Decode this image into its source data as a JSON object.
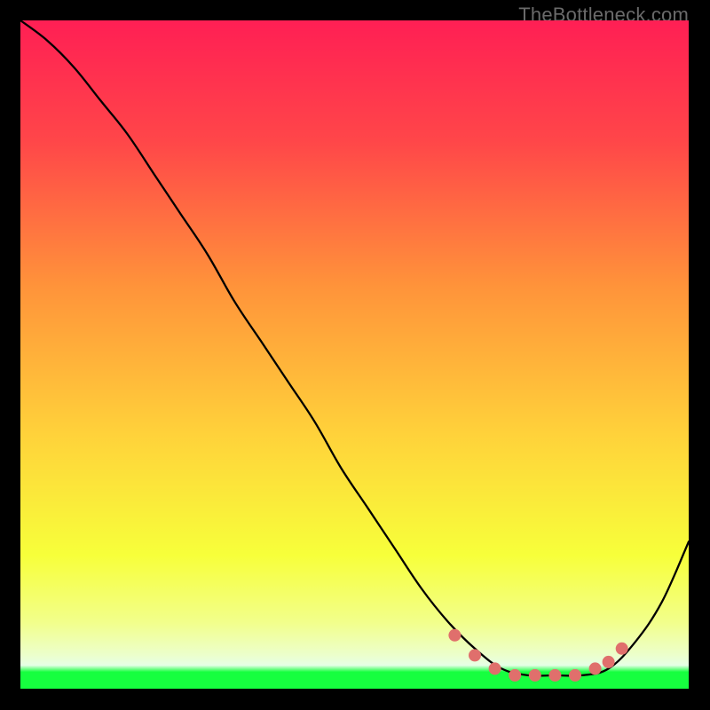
{
  "watermark": "TheBottleneck.com",
  "colors": {
    "black": "#000000",
    "gradient_top": "#ff1f54",
    "gradient_upper_mid": "#ff6a3a",
    "gradient_mid": "#ffd23a",
    "gradient_lower_mid": "#f7ff3a",
    "gradient_green": "#16ff3f",
    "curve": "#000000",
    "dots": "#e06f6c"
  },
  "chart_data": {
    "type": "line",
    "title": "",
    "xlabel": "",
    "ylabel": "",
    "x_range": [
      0,
      100
    ],
    "y_range": [
      0,
      100
    ],
    "series": [
      {
        "name": "bottleneck-curve",
        "x": [
          0,
          4,
          8,
          12,
          16,
          20,
          24,
          28,
          32,
          36,
          40,
          44,
          48,
          52,
          56,
          60,
          64,
          68,
          72,
          76,
          80,
          84,
          88,
          92,
          96,
          100
        ],
        "y": [
          100,
          97,
          93,
          88,
          83,
          77,
          71,
          65,
          58,
          52,
          46,
          40,
          33,
          27,
          21,
          15,
          10,
          6,
          3,
          2,
          2,
          2,
          3,
          7,
          13,
          22
        ]
      }
    ],
    "sweet_spot_dots": {
      "name": "sweet-spot",
      "x": [
        65,
        68,
        71,
        74,
        77,
        80,
        83,
        86,
        88,
        90
      ],
      "y": [
        8,
        5,
        3,
        2,
        2,
        2,
        2,
        3,
        4,
        6
      ]
    }
  }
}
